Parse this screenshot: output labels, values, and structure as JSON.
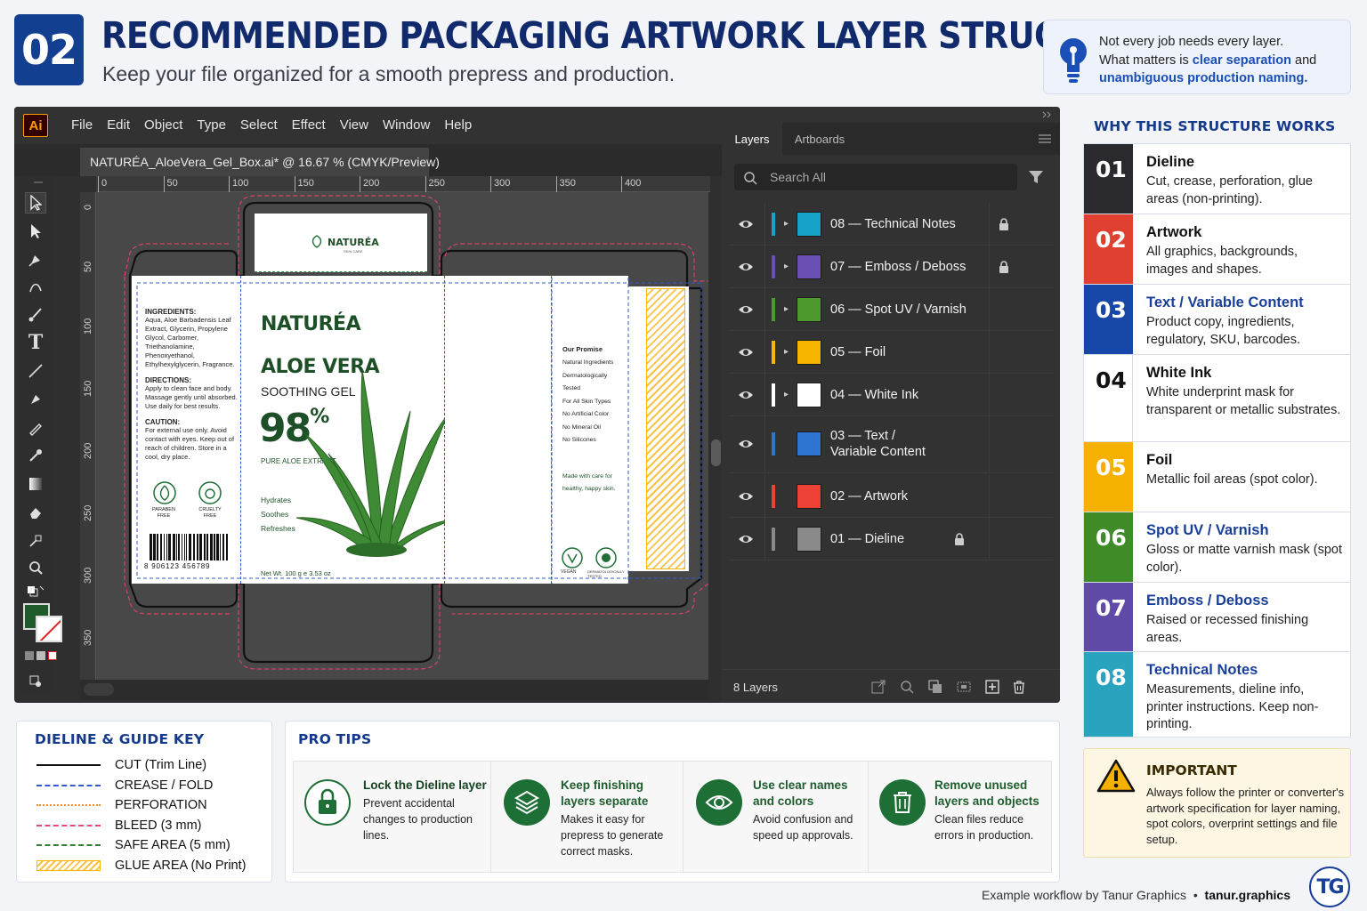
{
  "header": {
    "number": "02",
    "title": "RECOMMENDED PACKAGING ARTWORK LAYER STRUCTURE",
    "subtitle": "Keep your file organized for a smooth prepress and production."
  },
  "note": {
    "line1": "Not every job needs every layer.",
    "line2_pre": "What matters is ",
    "line2_hl": "clear separation",
    "line2_post": " and",
    "line3_hl": "unambiguous production naming."
  },
  "app": {
    "logo": "Ai",
    "menu": [
      "File",
      "Edit",
      "Object",
      "Type",
      "Select",
      "Effect",
      "View",
      "Window",
      "Help"
    ],
    "doc_tab": "NATURÉA_AloeVera_Gel_Box.ai* @ 16.67 % (CMYK/Preview)",
    "ruler_top": [
      "0",
      "50",
      "100",
      "150",
      "200",
      "250",
      "300",
      "350",
      "400"
    ],
    "ruler_left": [
      "0",
      "50",
      "100",
      "150",
      "200",
      "250",
      "300",
      "350"
    ]
  },
  "box_art": {
    "brand_small": "NATURÉA",
    "brand_small_sub": "SKIN CARE",
    "brand": "NATURÉA",
    "product": "ALOE VERA",
    "product_sub": "SOOTHING GEL",
    "percent": "98",
    "percent_sign": "%",
    "extract": "PURE ALOE EXTRACT",
    "benefits": [
      "Hydrates",
      "Soothes",
      "Refreshes"
    ],
    "net_wt": "Net Wt. 100 g e 3.53 oz",
    "ingredients_head": "INGREDIENTS:",
    "ingredients": "Aqua, Aloe Barbadensis Leaf Extract, Glycerin, Propylene Glycol, Carbomer, Triethanolamine, Phenoxyethanol, Ethylhexylglycerin, Fragrance.",
    "directions_head": "DIRECTIONS:",
    "directions": "Apply to clean face and body. Massage gently until absorbed. Use daily for best results.",
    "caution_head": "CAUTION:",
    "caution": "For external use only. Avoid contact with eyes. Keep out of reach of children. Store in a cool, dry place.",
    "badge1": "PARABEN FREE",
    "badge2": "CRUELTY FREE",
    "barcode_num": "8 906123 456789",
    "promise_head": "Our Promise",
    "promise": [
      "Natural Ingredients",
      "Dermatologically Tested",
      "For All Skin Types",
      "No Artificial Color",
      "No Mineral Oil",
      "No Silicones"
    ],
    "made_with": "Made with care for healthy, happy skin.",
    "badge3": "VEGAN",
    "badge4": "DERMATOLOGICALLY TESTED"
  },
  "layers_panel": {
    "tab_layers": "Layers",
    "tab_artboards": "Artboards",
    "search_placeholder": "Search All",
    "count": "8 Layers",
    "layers": [
      {
        "name": "08 — Technical Notes",
        "color": "#17a2c8",
        "bar": "#17a2c8",
        "locked": true
      },
      {
        "name": "07 — Emboss / Deboss",
        "color": "#6a4fb5",
        "bar": "#6a4fb5",
        "locked": true
      },
      {
        "name": "06 — Spot UV / Varnish",
        "color": "#4e9a2e",
        "bar": "#4e9a2e",
        "locked": false
      },
      {
        "name": "05 — Foil",
        "color": "#f7b500",
        "bar": "#f7b500",
        "locked": false
      },
      {
        "name": "04 — White Ink",
        "color": "#ffffff",
        "bar": "#ffffff",
        "locked": false
      },
      {
        "name": "03 — Text /",
        "name2": "Variable Content",
        "color": "#2f74d0",
        "bar": "#2f74d0",
        "locked": false
      },
      {
        "name": "02 — Artwork",
        "color": "#ee4136",
        "bar": "#ee4136",
        "locked": false
      },
      {
        "name": "01 — Dieline",
        "color": "#8a8a8a",
        "bar": "#8a8a8a",
        "locked": true
      }
    ]
  },
  "key": {
    "title": "DIELINE & GUIDE KEY",
    "items": [
      {
        "label": "CUT",
        "sub": "(Trim Line)"
      },
      {
        "label": "CREASE / FOLD",
        "sub": ""
      },
      {
        "label": "PERFORATION",
        "sub": ""
      },
      {
        "label": "BLEED",
        "sub": "(3 mm)"
      },
      {
        "label": "SAFE AREA",
        "sub": "(5 mm)"
      },
      {
        "label": "GLUE AREA",
        "sub": "(No Print)"
      }
    ]
  },
  "tips": {
    "title": "PRO TIPS",
    "items": [
      {
        "title": "Lock the Dieline layer",
        "desc": "Prevent accidental changes to production lines."
      },
      {
        "title": "Keep finishing layers separate",
        "desc": "Makes it easy for prepress to generate correct masks."
      },
      {
        "title": "Use clear names and colors",
        "desc": "Avoid confusion and speed up approvals."
      },
      {
        "title": "Remove unused layers and objects",
        "desc": "Clean files reduce errors in production."
      }
    ]
  },
  "why": {
    "title": "WHY THIS STRUCTURE WORKS",
    "items": [
      {
        "num": "01",
        "color": "#2a2a2e",
        "title": "Dieline",
        "desc": "Cut, crease, perforation, glue areas (non-printing)."
      },
      {
        "num": "02",
        "color": "#e0402f",
        "title": "Artwork",
        "desc": "All graphics, backgrounds, images and shapes."
      },
      {
        "num": "03",
        "color": "#1646a8",
        "title": "Text / Variable Content",
        "desc": "Product copy, ingredients, regulatory, SKU, barcodes."
      },
      {
        "num": "04",
        "color": "#ffffff",
        "title": "White Ink",
        "desc": "White underprint mask for transparent or metallic substrates."
      },
      {
        "num": "05",
        "color": "#f5b100",
        "title": "Foil",
        "desc": "Metallic foil areas (spot color)."
      },
      {
        "num": "06",
        "color": "#3f8b28",
        "title": "Spot UV / Varnish",
        "desc": "Gloss or matte varnish mask (spot color)."
      },
      {
        "num": "07",
        "color": "#5f4aa8",
        "title": "Emboss / Deboss",
        "desc": "Raised or recessed finishing areas."
      },
      {
        "num": "08",
        "color": "#2aa3bf",
        "title": "Technical Notes",
        "desc": "Measurements, dieline info, printer instructions. Keep non-printing."
      }
    ]
  },
  "important": {
    "title": "IMPORTANT",
    "text": "Always follow the printer or converter's artwork specification for layer naming, spot colors, overprint settings and file setup."
  },
  "credit": {
    "text": "Example workflow by Tanur Graphics",
    "sep": "•",
    "site": "tanur.graphics",
    "logo": "TG"
  }
}
